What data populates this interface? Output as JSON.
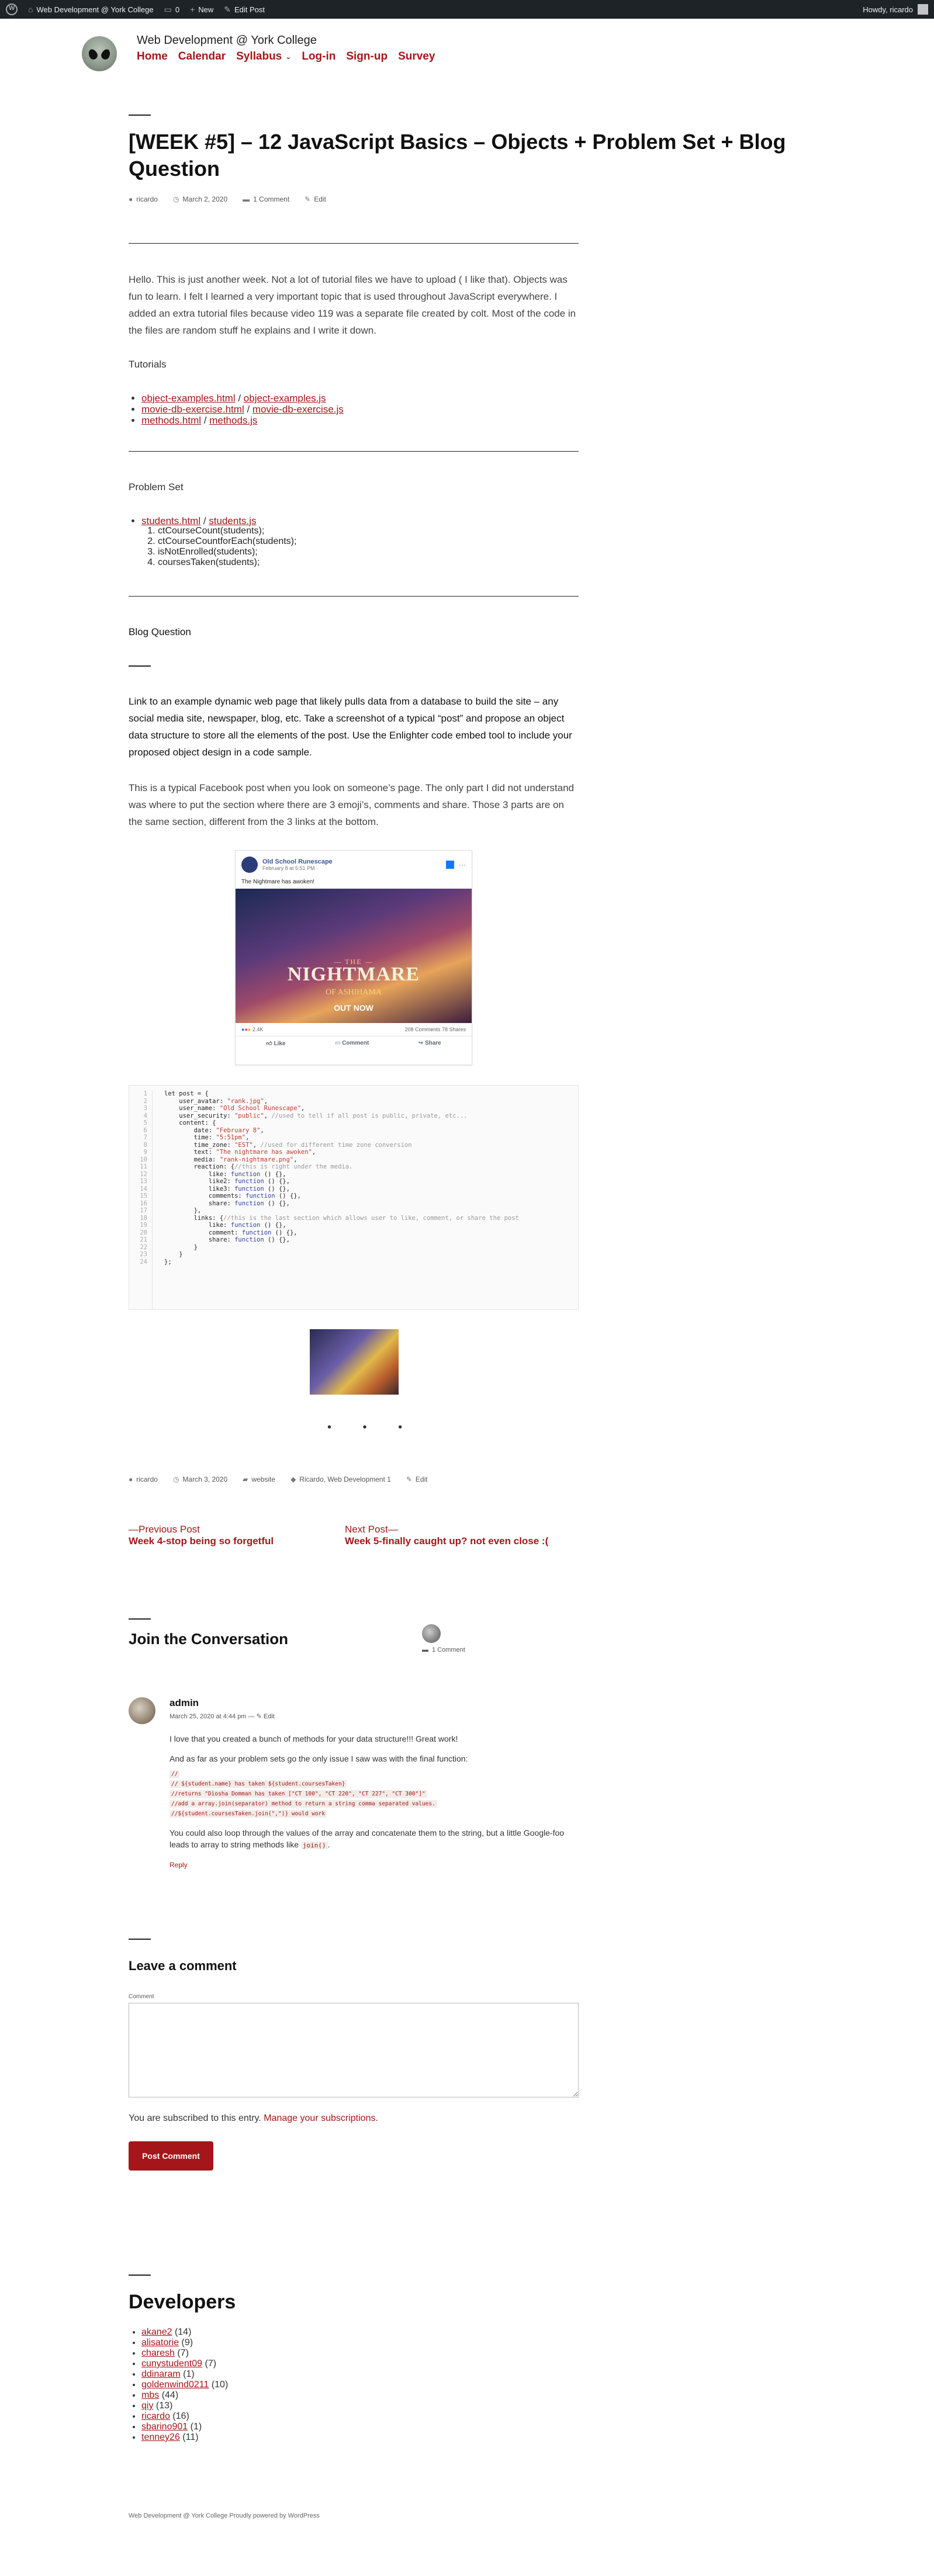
{
  "adminbar": {
    "site_name": "Web Development @ York College",
    "comments_count": "0",
    "new_label": "New",
    "edit_label": "Edit Post",
    "howdy": "Howdy, ricardo"
  },
  "header": {
    "site_title": "Web Development @ York College",
    "nav": [
      "Home",
      "Calendar",
      "Syllabus",
      "Log-in",
      "Sign-up",
      "Survey"
    ]
  },
  "post": {
    "title": "[WEEK #5] – 12 JavaScript Basics – Objects + Problem Set + Blog Question",
    "author": "ricardo",
    "date": "March 2, 2020",
    "comments": "1 Comment",
    "edit": "Edit",
    "intro": "Hello. This is just another week. Not a lot of tutorial files we have to upload ( I like that). Objects was fun to learn. I felt I learned a very important topic that is used throughout JavaScript everywhere. I added an extra tutorial files because video 119 was a separate file created by colt. Most of the code in the files are random stuff he explains and I write it down.",
    "tutorials_heading": "Tutorials",
    "tutorials": [
      [
        "object-examples.html",
        "object-examples.js"
      ],
      [
        "movie-db-exercise.html",
        "movie-db-exercise.js"
      ],
      [
        "methods.html",
        "methods.js"
      ]
    ],
    "problem_set_heading": "Problem Set",
    "problem_set_links": [
      "students.html",
      "students.js"
    ],
    "problem_set_items": [
      "ctCourseCount(students);",
      "ctCourseCountforEach(students);",
      "isNotEnrolled(students);",
      "coursesTaken(students);"
    ],
    "blog_heading": "Blog Question",
    "blog_question": "Link to an example dynamic web page that likely pulls data from a database to build the site – any social media site, newspaper, blog, etc. Take a screenshot of a typical “post” and propose an object data structure to store all the elements of the post. Use the Enlighter code embed tool to include your proposed object design in a code sample.",
    "blog_answer": "This is a typical Facebook post when you look on someone’s page. The only part I did not understand was where to put the section where there are 3 emoji’s, comments and share. Those 3 parts are on the same section, different from the 3 links at the bottom.",
    "dots": "• • •",
    "footer_date": "March 3, 2020",
    "footer_category": "website",
    "footer_tags": "Ricardo, Web Development 1",
    "footer_edit": "Edit"
  },
  "facebook": {
    "page": "Old School Runescape",
    "date": "February 8 at 5:51 PM · ",
    "text": "The Nightmare has awoken!",
    "img_the": "— THE —",
    "img_title": "NIGHTMARE",
    "img_sub": "OF ASHIHAMA",
    "img_cta": "OUT NOW",
    "reactions": "2.4K",
    "stats": "208 Comments  78 Shares",
    "actions": [
      "Like",
      "Comment",
      "Share"
    ]
  },
  "code": {
    "lines": [
      [
        [
          "k",
          "let post = {"
        ]
      ],
      [
        [
          "k",
          "    user_avatar: "
        ],
        [
          "s",
          "\"rank.jpg\""
        ],
        [
          "k",
          ","
        ]
      ],
      [
        [
          "k",
          "    user_name: "
        ],
        [
          "s",
          "\"Old School Runescape\""
        ],
        [
          "k",
          ","
        ]
      ],
      [
        [
          "k",
          "    user_security: "
        ],
        [
          "s",
          "\"public\""
        ],
        [
          "k",
          ", "
        ],
        [
          "c",
          "//used to tell if all post is public, private, etc..."
        ]
      ],
      [
        [
          "k",
          "    content: {"
        ]
      ],
      [
        [
          "k",
          "        date: "
        ],
        [
          "s",
          "\"February 8\""
        ],
        [
          "k",
          ","
        ]
      ],
      [
        [
          "k",
          "        time: "
        ],
        [
          "s",
          "\"5:51pm\""
        ],
        [
          "k",
          ","
        ]
      ],
      [
        [
          "k",
          "        time_zone: "
        ],
        [
          "s",
          "\"EST\""
        ],
        [
          "k",
          ", "
        ],
        [
          "c",
          "//used for different time zone conversion"
        ]
      ],
      [
        [
          "k",
          "        text: "
        ],
        [
          "s",
          "\"The nightmare has awoken\""
        ],
        [
          "k",
          ","
        ]
      ],
      [
        [
          "k",
          "        media: "
        ],
        [
          "s",
          "\"rank-nightmare.png\""
        ],
        [
          "k",
          ","
        ]
      ],
      [
        [
          "k",
          "        reaction: {"
        ],
        [
          "c",
          "//this is right under the media."
        ]
      ],
      [
        [
          "k",
          "            like: "
        ],
        [
          "f",
          "function"
        ],
        [
          "k",
          " () {},"
        ]
      ],
      [
        [
          "k",
          "            like2: "
        ],
        [
          "f",
          "function"
        ],
        [
          "k",
          " () {},"
        ]
      ],
      [
        [
          "k",
          "            like3: "
        ],
        [
          "f",
          "function"
        ],
        [
          "k",
          " () {},"
        ]
      ],
      [
        [
          "k",
          "            comments: "
        ],
        [
          "f",
          "function"
        ],
        [
          "k",
          " () {},"
        ]
      ],
      [
        [
          "k",
          "            share: "
        ],
        [
          "f",
          "function"
        ],
        [
          "k",
          " () {},"
        ]
      ],
      [
        [
          "k",
          "        },"
        ]
      ],
      [
        [
          "k",
          "        links: {"
        ],
        [
          "c",
          "//this is the last section which allows user to like, comment, or share the post"
        ]
      ],
      [
        [
          "k",
          "            like: "
        ],
        [
          "f",
          "function"
        ],
        [
          "k",
          " () {},"
        ]
      ],
      [
        [
          "k",
          "            comment: "
        ],
        [
          "f",
          "function"
        ],
        [
          "k",
          " () {},"
        ]
      ],
      [
        [
          "k",
          "            share: "
        ],
        [
          "f",
          "function"
        ],
        [
          "k",
          " () {},"
        ]
      ],
      [
        [
          "k",
          "        }"
        ]
      ],
      [
        [
          "k",
          "    }"
        ]
      ],
      [
        [
          "k",
          "};"
        ]
      ]
    ]
  },
  "postnav": {
    "prev_label": "—Previous Post",
    "prev_title": "Week 4-stop being so forgetful",
    "next_label": "Next Post—",
    "next_title": "Week 5-finally caught up? not even close :("
  },
  "conversation": {
    "heading": "Join the Conversation",
    "count": "1 Comment"
  },
  "comment": {
    "author": "admin",
    "date": "March 25, 2020 at 4:44 pm",
    "edit": "Edit",
    "p1": "I love that you created a bunch of methods for your data structure!!! Great work!",
    "p2": "And as far as your problem sets go the only issue I saw was with the final function:",
    "code_lines": [
      "//",
      "// ${student.name} has taken ${student.coursesTaken}",
      "//returns \"Diosha Domman has taken [\"CT 100\", \"CT 220\", \"CT 227\", \"CT 300\"]\"",
      "//add a array.join(separator) method to return a string comma separated values.",
      "//${student.coursesTaken.join(\",\")} would work"
    ],
    "p3_a": "You could also loop through the values of the array and concatenate them to the string, but a little Google-foo leads to array to string methods like ",
    "p3_code": "join()",
    "p3_b": ".",
    "reply": "Reply"
  },
  "form": {
    "heading": "Leave a comment",
    "label": "Comment",
    "subscribed_text": "You are subscribed to this entry. ",
    "subscribed_link": "Manage your subscriptions",
    "subscribed_end": ".",
    "submit": "Post Comment"
  },
  "developers": {
    "heading": "Developers",
    "items": [
      {
        "name": "akane2",
        "count": "(14)"
      },
      {
        "name": "alisatorie",
        "count": "(9)"
      },
      {
        "name": "charesh",
        "count": "(7)"
      },
      {
        "name": "cunystudent09",
        "count": "(7)"
      },
      {
        "name": "ddinaram",
        "count": "(1)"
      },
      {
        "name": "goldenwind0211",
        "count": "(10)"
      },
      {
        "name": "mbs",
        "count": "(44)"
      },
      {
        "name": "qiy",
        "count": "(13)"
      },
      {
        "name": "ricardo",
        "count": "(16)"
      },
      {
        "name": "sbarino901",
        "count": "(1)"
      },
      {
        "name": "tenney26",
        "count": "(11)"
      }
    ]
  },
  "footer": {
    "text": "Web Development @ York College Proudly powered by WordPress"
  }
}
